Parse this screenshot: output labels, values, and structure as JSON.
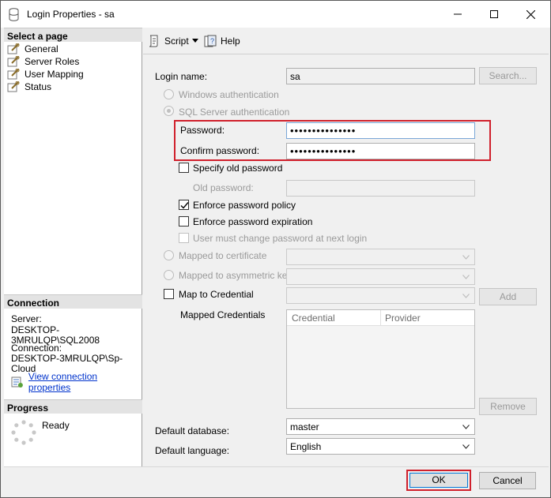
{
  "window": {
    "title": "Login Properties - sa"
  },
  "left": {
    "select_page_header": "Select a page",
    "pages": [
      {
        "label": "General"
      },
      {
        "label": "Server Roles"
      },
      {
        "label": "User Mapping"
      },
      {
        "label": "Status"
      }
    ],
    "connection_header": "Connection",
    "server_label": "Server:",
    "server_value": "DESKTOP-3MRULQP\\SQL2008",
    "connection_label": "Connection:",
    "connection_value": "DESKTOP-3MRULQP\\Sp-Cloud",
    "view_connection_link": "View connection properties",
    "progress_header": "Progress",
    "progress_status": "Ready"
  },
  "toolbar": {
    "script_label": "Script",
    "help_label": "Help"
  },
  "general": {
    "login_name_label": "Login name:",
    "login_name_value": "sa",
    "search_button": "Search...",
    "windows_auth_label": "Windows authentication",
    "sql_auth_label": "SQL Server authentication",
    "password_label": "Password:",
    "password_value": "•••••••••••••••",
    "confirm_password_label": "Confirm password:",
    "confirm_password_value": "•••••••••••••••",
    "specify_old_password_label": "Specify old password",
    "old_password_label": "Old password:",
    "enforce_policy_label": "Enforce password policy",
    "enforce_policy_checked": true,
    "enforce_expiration_label": "Enforce password expiration",
    "must_change_label": "User must change password at next login",
    "mapped_cert_label": "Mapped to certificate",
    "mapped_asym_label": "Mapped to asymmetric key",
    "map_credential_label": "Map to Credential",
    "add_button": "Add",
    "mapped_credentials_label": "Mapped Credentials",
    "credential_columns": [
      "Credential",
      "Provider"
    ],
    "remove_button": "Remove",
    "default_database_label": "Default database:",
    "default_database_value": "master",
    "default_language_label": "Default language:",
    "default_language_value": "English"
  },
  "footer": {
    "ok_button": "OK",
    "cancel_button": "Cancel"
  }
}
